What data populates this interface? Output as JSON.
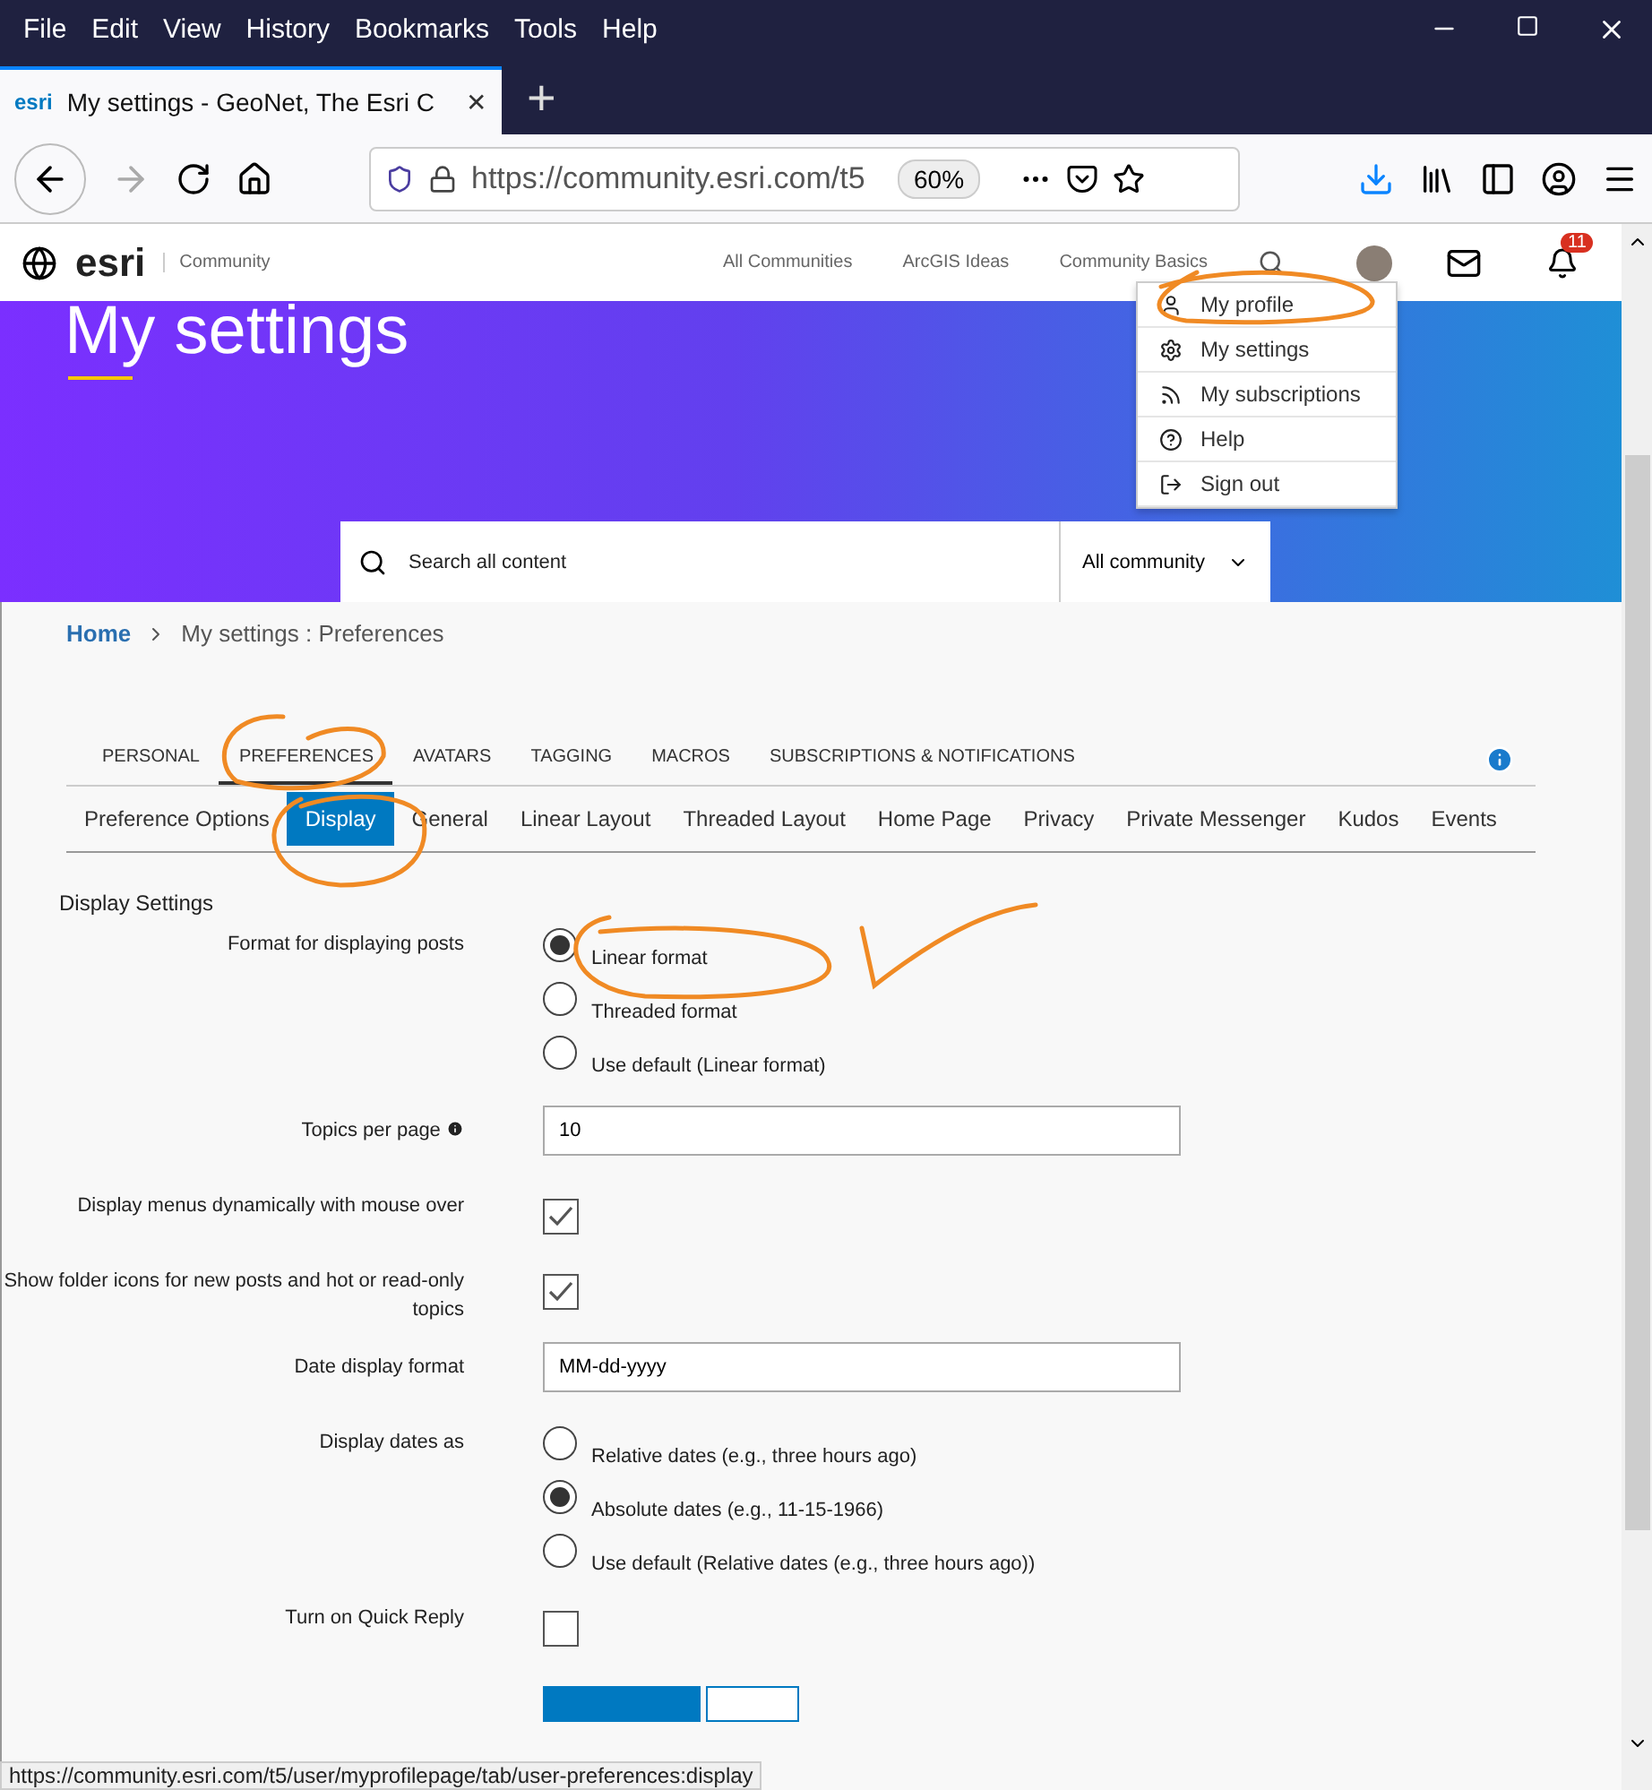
{
  "browser": {
    "menu": [
      "File",
      "Edit",
      "View",
      "History",
      "Bookmarks",
      "Tools",
      "Help"
    ],
    "tab": {
      "favicon": "esri",
      "title": "My settings - GeoNet, The Esri C",
      "close": "✕"
    },
    "new_tab": "+",
    "address": {
      "url": "https://community.esri.com/t5",
      "zoom": "60%"
    }
  },
  "site": {
    "logo": "esri",
    "section": "Community",
    "nav": [
      "All Communities",
      "ArcGIS Ideas",
      "Community Basics"
    ],
    "notifications": "11",
    "user_menu": [
      {
        "label": "My profile"
      },
      {
        "label": "My settings"
      },
      {
        "label": "My subscriptions"
      },
      {
        "label": "Help"
      },
      {
        "label": "Sign out"
      }
    ]
  },
  "banner": {
    "title": "My settings",
    "search_placeholder": "Search all content",
    "scope": "All community"
  },
  "breadcrumb": [
    "Home",
    "My settings : Preferences"
  ],
  "tabs": [
    {
      "label": "PERSONAL",
      "selected": false
    },
    {
      "label": "PREFERENCES",
      "selected": true
    },
    {
      "label": "AVATARS",
      "selected": false
    },
    {
      "label": "TAGGING",
      "selected": false
    },
    {
      "label": "MACROS",
      "selected": false
    },
    {
      "label": "SUBSCRIPTIONS & NOTIFICATIONS",
      "selected": false
    }
  ],
  "subtabs": [
    {
      "label": "Preference Options",
      "selected": false
    },
    {
      "label": "Display",
      "selected": true
    },
    {
      "label": "General",
      "selected": false
    },
    {
      "label": "Linear Layout",
      "selected": false
    },
    {
      "label": "Threaded Layout",
      "selected": false
    },
    {
      "label": "Home Page",
      "selected": false
    },
    {
      "label": "Privacy",
      "selected": false
    },
    {
      "label": "Private Messenger",
      "selected": false
    },
    {
      "label": "Kudos",
      "selected": false
    },
    {
      "label": "Events",
      "selected": false
    }
  ],
  "section_title": "Display Settings",
  "fields": [
    {
      "kind": "radio",
      "label": "Format for displaying posts",
      "options": [
        {
          "label": "Linear format",
          "selected": true
        },
        {
          "label": "Threaded format",
          "selected": false
        },
        {
          "label": "Use default (Linear format)",
          "selected": false
        }
      ]
    },
    {
      "kind": "text",
      "label": "Topics per page",
      "info": true,
      "value": "10"
    },
    {
      "kind": "checkbox",
      "label": "Display menus dynamically with mouse over",
      "checked": true
    },
    {
      "kind": "checkbox",
      "label": "Show folder icons for new posts and hot or read-only topics",
      "checked": true
    },
    {
      "kind": "text",
      "label": "Date display format",
      "value": "MM-dd-yyyy"
    },
    {
      "kind": "radio",
      "label": "Display dates as",
      "options": [
        {
          "label": "Relative dates (e.g., three hours ago)",
          "selected": false
        },
        {
          "label": "Absolute dates (e.g., 11-15-1966)",
          "selected": true
        },
        {
          "label": "Use default (Relative dates (e.g., three hours ago))",
          "selected": false
        }
      ]
    },
    {
      "kind": "checkbox",
      "label": "Turn on Quick Reply",
      "checked": false
    }
  ],
  "buttons": [
    {
      "kind": "primary"
    },
    {
      "kind": "secondary"
    }
  ],
  "status_url": "https://community.esri.com/t5/user/myprofilepage/tab/user-preferences:display"
}
